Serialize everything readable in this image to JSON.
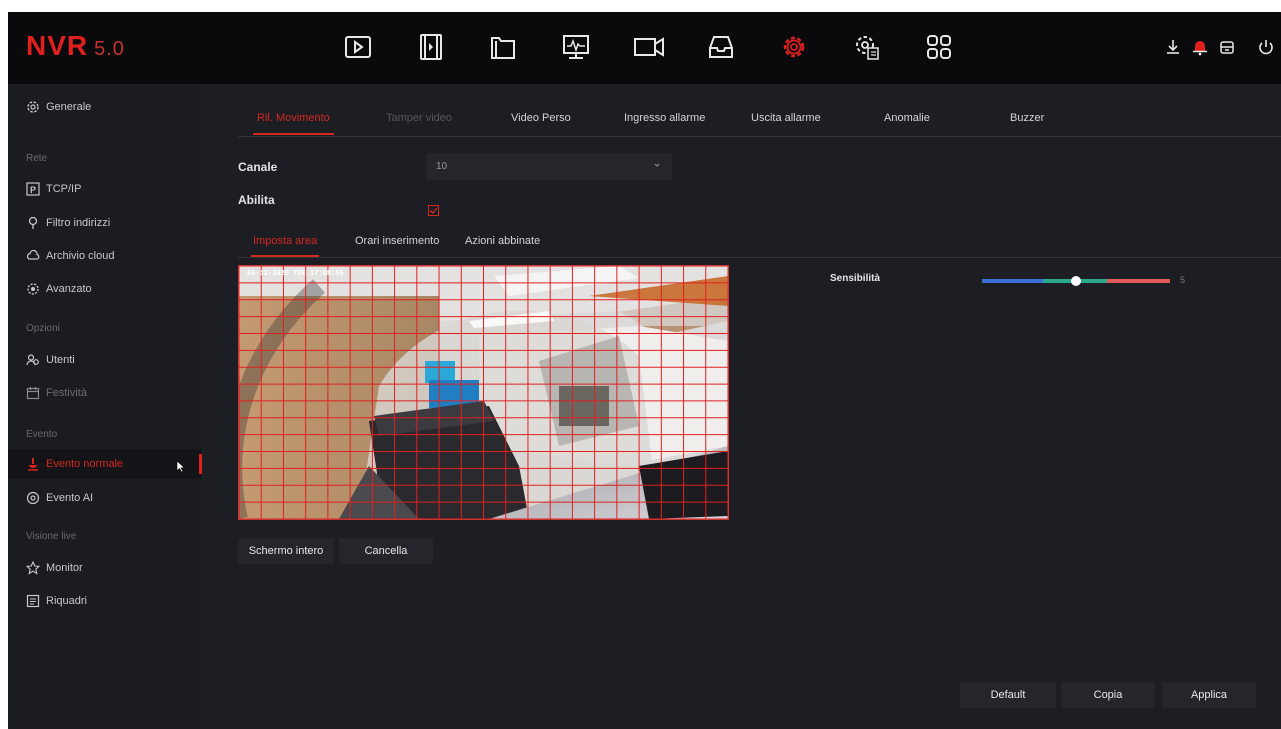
{
  "app": {
    "logo": "NVR",
    "version": "5.0"
  },
  "top_nav": {
    "icons": [
      "playback-icon",
      "clips-icon",
      "files-icon",
      "system-monitor-icon",
      "camera-icon",
      "storage-icon",
      "settings-icon",
      "advanced-settings-icon",
      "apps-grid-icon"
    ],
    "active": "settings-icon",
    "right_icons": [
      "download-icon",
      "alarm-bell-icon",
      "backup-icon",
      "power-icon"
    ]
  },
  "sidebar": {
    "general": "Generale",
    "cat_rete": "Rete",
    "tcpip": "TCP/IP",
    "filtro": "Filtro indirizzi",
    "archivio": "Archivio cloud",
    "avanzato": "Avanzato",
    "cat_opzioni": "Opzioni",
    "utenti": "Utenti",
    "festivita": "Festività",
    "cat_evento": "Evento",
    "evento_normale": "Evento normale",
    "evento_ai": "Evento AI",
    "cat_visione": "Visione live",
    "monitor": "Monitor",
    "riquadri": "Riquadri"
  },
  "tabs": {
    "movimento": "Ril. Movimento",
    "tamper": "Tamper video",
    "perso": "Video Perso",
    "ingresso": "Ingresso allarme",
    "uscita": "Uscita allarme",
    "anomalie": "Anomalie",
    "buzzer": "Buzzer"
  },
  "form": {
    "canale_label": "Canale",
    "canale_value": "10",
    "abilita_label": "Abilita",
    "abilita_checked": true
  },
  "subtabs": {
    "area": "Imposta area",
    "orari": "Orari inserimento",
    "azioni": "Azioni abbinate"
  },
  "video": {
    "timestamp": "06-12-2020 TUE 17:08:55",
    "grid_color": "#e0201f"
  },
  "sensitivity": {
    "label": "Sensibilità",
    "value": "5",
    "level_fraction": 0.5
  },
  "buttons": {
    "schermo": "Schermo intero",
    "cancella": "Cancella",
    "default": "Default",
    "copia": "Copia",
    "applica": "Applica"
  },
  "colors": {
    "accent": "#e0201f",
    "background": "#1d1e23",
    "topbar": "#0a0a0c"
  }
}
